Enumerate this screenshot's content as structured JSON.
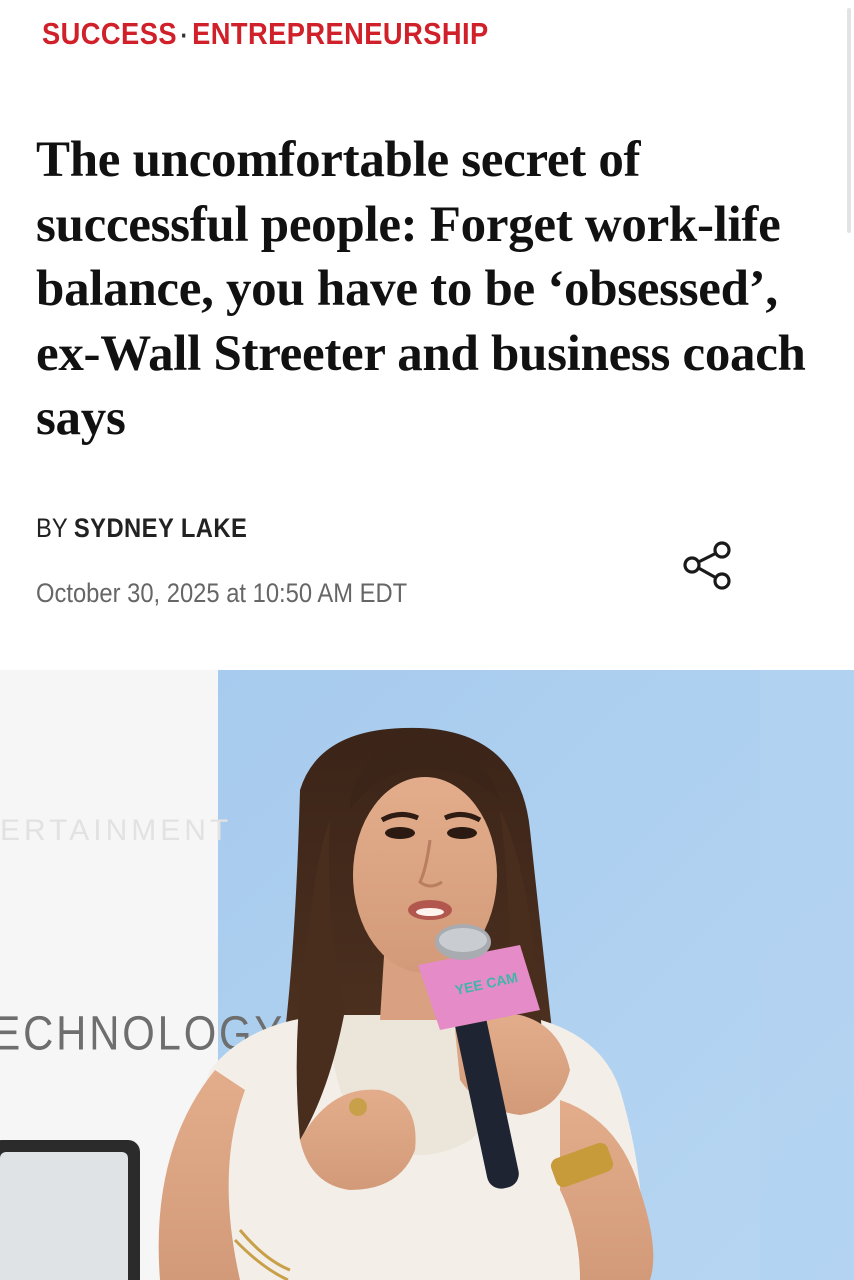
{
  "breadcrumb": {
    "section": "SUCCESS",
    "separator": "·",
    "subsection": "ENTREPRENEURSHIP"
  },
  "article": {
    "headline": "The uncomfortable secret of successful people: Forget work-life balance, you have to be ‘obsessed’, ex-Wall Streeter and business coach says",
    "byline_prefix": "BY",
    "author": "SYDNEY LAKE",
    "date": "October 30, 2025 at 10:50 AM EDT"
  },
  "photo": {
    "backdrop_text": "ECHNOLOGY",
    "mic_flag_text": "YEE CAM"
  },
  "icons": {
    "share": "share-icon"
  },
  "colors": {
    "accent": "#d0202a",
    "headline": "#111111",
    "meta": "#666666",
    "photo_backdrop": "#a9cdf0"
  }
}
